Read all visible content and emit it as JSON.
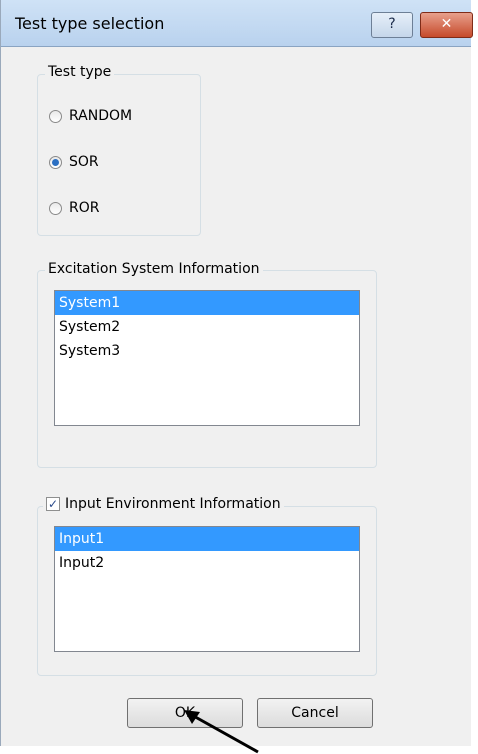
{
  "window": {
    "title": "Test type selection",
    "help_label": "?",
    "close_label": "✕"
  },
  "test_type": {
    "legend": "Test type",
    "options": [
      {
        "label": "RANDOM",
        "selected": false
      },
      {
        "label": "SOR",
        "selected": true
      },
      {
        "label": "ROR",
        "selected": false
      }
    ]
  },
  "excitation": {
    "legend": "Excitation System Information",
    "items": [
      "System1",
      "System2",
      "System3"
    ],
    "selected_index": 0
  },
  "input_env": {
    "legend": "Input Environment Information",
    "checked": true,
    "check_glyph": "✓",
    "items": [
      "Input1",
      "Input2"
    ],
    "selected_index": 0
  },
  "buttons": {
    "ok": "OK",
    "cancel": "Cancel"
  },
  "colors": {
    "selection": "#3399ff",
    "title_bg": "#b9d2ee",
    "close": "#c64a2b"
  }
}
